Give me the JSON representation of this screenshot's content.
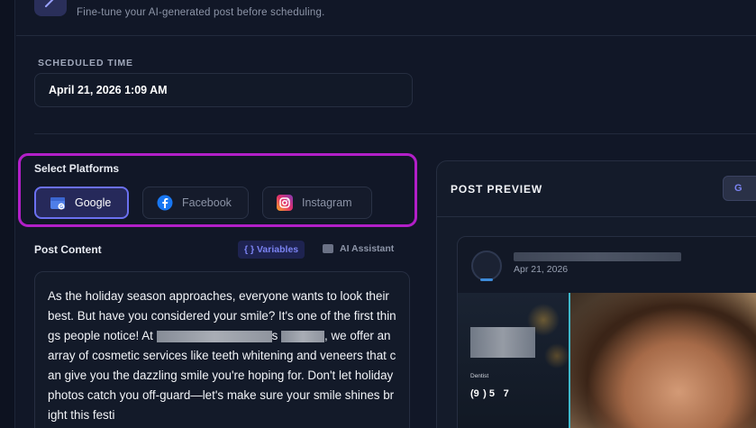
{
  "header": {
    "subtitle": "Fine-tune your AI-generated post before scheduling."
  },
  "schedule": {
    "label": "SCHEDULED TIME",
    "value": "April 21, 2026 1:09 AM"
  },
  "platforms": {
    "title": "Select Platforms",
    "items": [
      {
        "label": "Google",
        "icon": "google-business-icon",
        "selected": true
      },
      {
        "label": "Facebook",
        "icon": "facebook-icon",
        "selected": false
      },
      {
        "label": "Instagram",
        "icon": "instagram-icon",
        "selected": false
      }
    ],
    "highlight_color": "#b21fc8"
  },
  "content": {
    "label": "Post Content",
    "variables_label": "{ } Variables",
    "ai_label": "AI Assistant",
    "text_part1": "As the holiday season approaches, everyone wants to look their best. But have you considered your smile? It's one of the first things people notice! At ",
    "text_part2": "s",
    "text_part3": ", we offer an array of cosmetic services like teeth whitening and veneers that can give you the dazzling smile you're hoping for. Don't let holiday photos catch you off-guard—let's make sure your smile shines bright this festi"
  },
  "preview": {
    "title": "POST PREVIEW",
    "tab_label": "G",
    "post_date": "Apr 21, 2026",
    "image_caption": "Dentist",
    "image_phone": "(9  ) 5    7    "
  },
  "colors": {
    "accent": "#6b70f0",
    "background": "#111727"
  }
}
